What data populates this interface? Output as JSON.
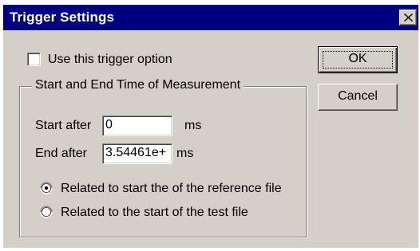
{
  "window": {
    "title": "Trigger Settings"
  },
  "trigger_option": {
    "label": "Use this trigger option",
    "checked": false
  },
  "group": {
    "legend": "Start and End Time of Measurement",
    "start": {
      "label": "Start after",
      "value": "0",
      "unit": "ms"
    },
    "end": {
      "label": "End after",
      "value": "3.54461e+",
      "unit": "ms"
    },
    "radio_options": [
      {
        "label": "Related to start the of the reference file",
        "selected": true
      },
      {
        "label": "Related to the start of the test file",
        "selected": false
      }
    ]
  },
  "buttons": {
    "ok": "OK",
    "cancel": "Cancel"
  },
  "icons": {
    "close": "close-icon"
  },
  "colors": {
    "titlebar": "#000080",
    "face": "#d4d0c8"
  }
}
